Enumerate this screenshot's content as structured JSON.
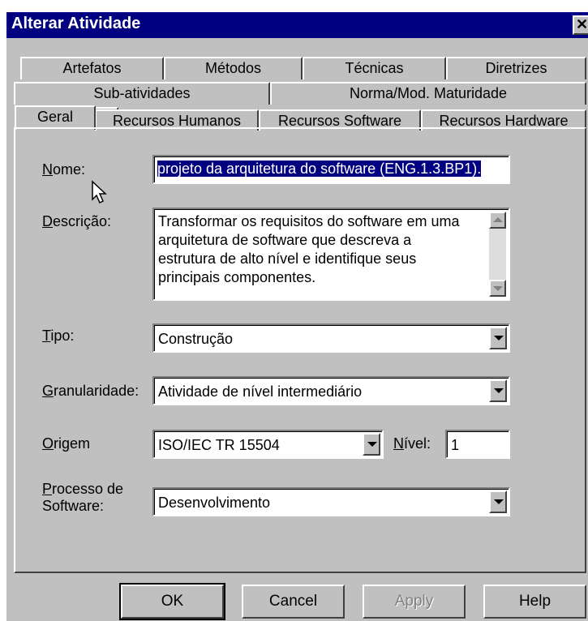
{
  "window": {
    "title": "Alterar Atividade",
    "close_glyph": "✕"
  },
  "tabs": {
    "row1": [
      "Artefatos",
      "Métodos",
      "Técnicas",
      "Diretrizes"
    ],
    "row2": [
      "Sub-atividades",
      "Norma/Mod. Maturidade"
    ],
    "row3": [
      "Geral",
      "Recursos Humanos",
      "Recursos Software",
      "Recursos Hardware"
    ],
    "active": "Geral"
  },
  "form": {
    "nome": {
      "label_u": "N",
      "label_rest": "ome:",
      "value": "projeto da arquitetura do software (ENG.1.3.BP1)."
    },
    "descricao": {
      "label_u": "D",
      "label_rest": "escrição:",
      "lines": [
        "Transformar os requisitos do software em uma",
        "arquitetura de software que descreva a",
        "estrutura de alto nível e identifique seus",
        "principais componentes."
      ]
    },
    "tipo": {
      "label_u": "T",
      "label_rest": "ipo:",
      "value": "Construção"
    },
    "granularidade": {
      "label_u": "G",
      "label_rest": "ranularidade:",
      "value": "Atividade de nível intermediário"
    },
    "origem": {
      "label_u": "O",
      "label_rest": "rigem",
      "value": "ISO/IEC TR 15504"
    },
    "nivel": {
      "label_u": "N",
      "label_rest": "ível:",
      "value": "1"
    },
    "processo": {
      "label_u": "P",
      "label_line1_rest": "rocesso de",
      "label_line2": "Software:",
      "value": "Desenvolvimento"
    }
  },
  "buttons": {
    "ok": "OK",
    "cancel": "Cancel",
    "apply": "Apply",
    "help": "Help"
  },
  "colors": {
    "titlebar": "#000080",
    "face": "#c0c0c0",
    "selection": "#000080"
  }
}
